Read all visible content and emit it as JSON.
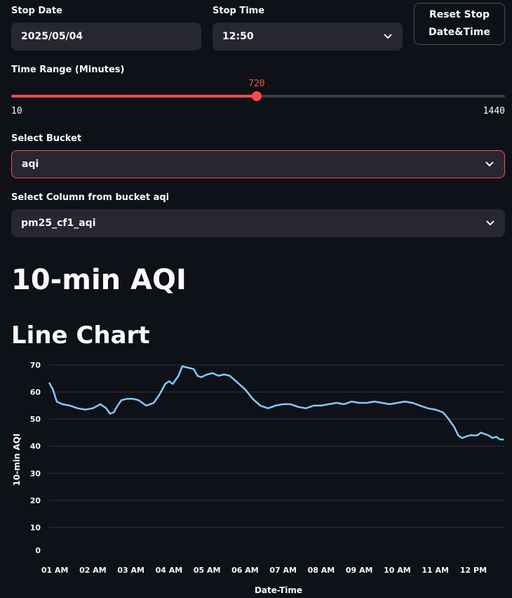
{
  "stop_date": {
    "label": "Stop Date",
    "value": "2025/05/04"
  },
  "stop_time": {
    "label": "Stop Time",
    "value": "12:50",
    "icon": "chevron-down-icon"
  },
  "reset_button": {
    "line1": "Reset Stop",
    "line2": "Date&Time"
  },
  "time_range": {
    "label": "Time Range (Minutes)",
    "value": "720",
    "min": "10",
    "max": "1440",
    "fraction": 0.497,
    "accent": "#ff4b4b"
  },
  "bucket": {
    "label": "Select Bucket",
    "value": "aqi",
    "icon": "chevron-down-icon",
    "border_color": "#ff4b4b"
  },
  "column": {
    "label": "Select Column from bucket aqi",
    "value": "pm25_cf1_aqi",
    "icon": "chevron-down-icon"
  },
  "headings": {
    "title": "10-min AQI",
    "subtitle": "Line Chart"
  },
  "chart_data": {
    "type": "line",
    "xlabel": "Date-Time",
    "ylabel": "10-min AQI",
    "line_color": "#83c9ff",
    "grid": true,
    "ylim": [
      0,
      70
    ],
    "y_ticks": [
      "0",
      "10",
      "20",
      "30",
      "40",
      "50",
      "60",
      "70"
    ],
    "x_ticks": [
      "01 AM",
      "02 AM",
      "03 AM",
      "04 AM",
      "05 AM",
      "06 AM",
      "07 AM",
      "08 AM",
      "09 AM",
      "10 AM",
      "11 AM",
      "12 PM"
    ],
    "x_range_hours": [
      0.85,
      12.83
    ],
    "x": [
      0.85,
      0.95,
      1.05,
      1.2,
      1.4,
      1.6,
      1.8,
      2.0,
      2.2,
      2.35,
      2.45,
      2.55,
      2.65,
      2.75,
      2.9,
      3.05,
      3.2,
      3.4,
      3.6,
      3.75,
      3.9,
      4.0,
      4.1,
      4.25,
      4.35,
      4.5,
      4.65,
      4.75,
      4.85,
      5.0,
      5.15,
      5.3,
      5.45,
      5.6,
      5.8,
      6.0,
      6.2,
      6.4,
      6.6,
      6.8,
      7.0,
      7.2,
      7.4,
      7.6,
      7.8,
      8.0,
      8.2,
      8.4,
      8.6,
      8.8,
      9.0,
      9.2,
      9.4,
      9.6,
      9.8,
      10.0,
      10.2,
      10.4,
      10.6,
      10.8,
      11.0,
      11.2,
      11.35,
      11.5,
      11.6,
      11.7,
      11.8,
      11.9,
      12.1,
      12.2,
      12.3,
      12.4,
      12.5,
      12.6,
      12.7,
      12.8
    ],
    "y": [
      63.5,
      61,
      56.5,
      55.5,
      55,
      54,
      53.5,
      54,
      55.5,
      54,
      52,
      52.5,
      55,
      57,
      57.5,
      57.5,
      57,
      55,
      56,
      59,
      63,
      64,
      63,
      66,
      69.5,
      69,
      68.5,
      66,
      65.5,
      66.5,
      67,
      66,
      66.5,
      66,
      63.5,
      61,
      57.5,
      55,
      54,
      55,
      55.5,
      55.5,
      54.5,
      54,
      55,
      55,
      55.5,
      56,
      55.5,
      56.5,
      56,
      56,
      56.5,
      56,
      55.5,
      56,
      56.5,
      56,
      55,
      54,
      53.5,
      52.5,
      50,
      47,
      44,
      43,
      43.5,
      44,
      44,
      45,
      44.5,
      44,
      43,
      43.5,
      42.5,
      42.5
    ]
  }
}
